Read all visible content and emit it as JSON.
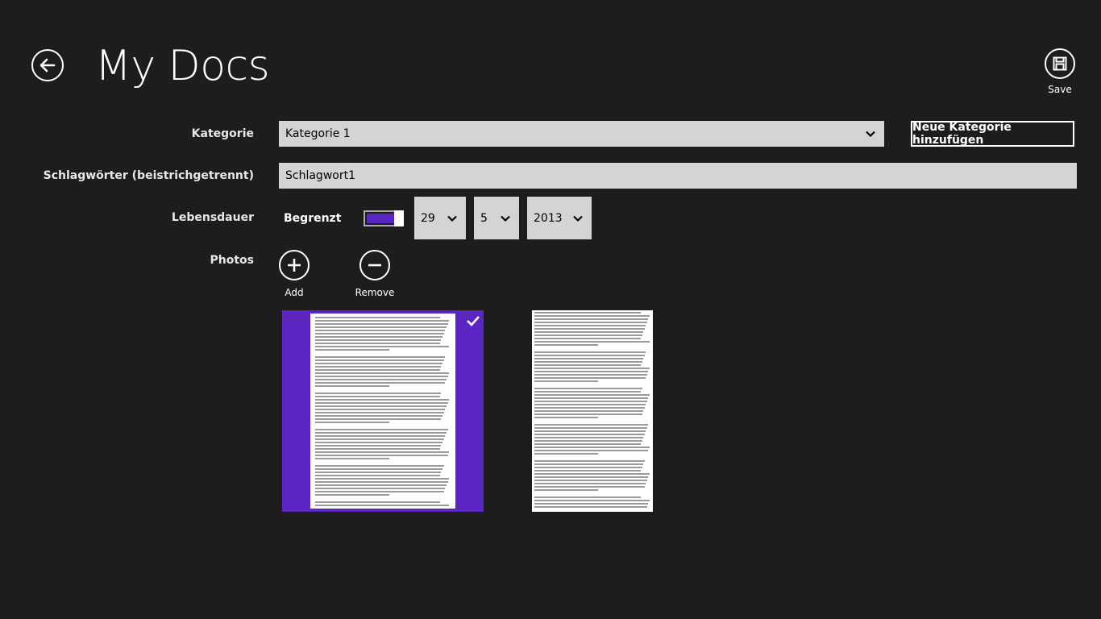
{
  "header": {
    "title": "My Docs",
    "back_icon": "back-arrow-icon",
    "save_label": "Save",
    "save_icon": "save-disk-icon"
  },
  "form": {
    "category_label": "Kategorie",
    "category_value": "Kategorie 1",
    "add_category_label": "Neue Kategorie hinzufügen",
    "tags_label": "Schlagwörter (beistrichgetrennt)",
    "tags_value": "Schlagwort1",
    "lifetime_label": "Lebensdauer",
    "toggle_label": "Begrenzt",
    "toggle_on": true,
    "day_value": "29",
    "month_value": "5",
    "year_value": "2013",
    "photos_label": "Photos",
    "add_label": "Add",
    "remove_label": "Remove"
  },
  "photos": [
    {
      "name": "document-page",
      "selected": true
    },
    {
      "name": "document-page",
      "selected": false
    }
  ],
  "colors": {
    "background": "#1d1d1d",
    "accent": "#5b25c2",
    "input_bg": "#d4d4d4"
  }
}
